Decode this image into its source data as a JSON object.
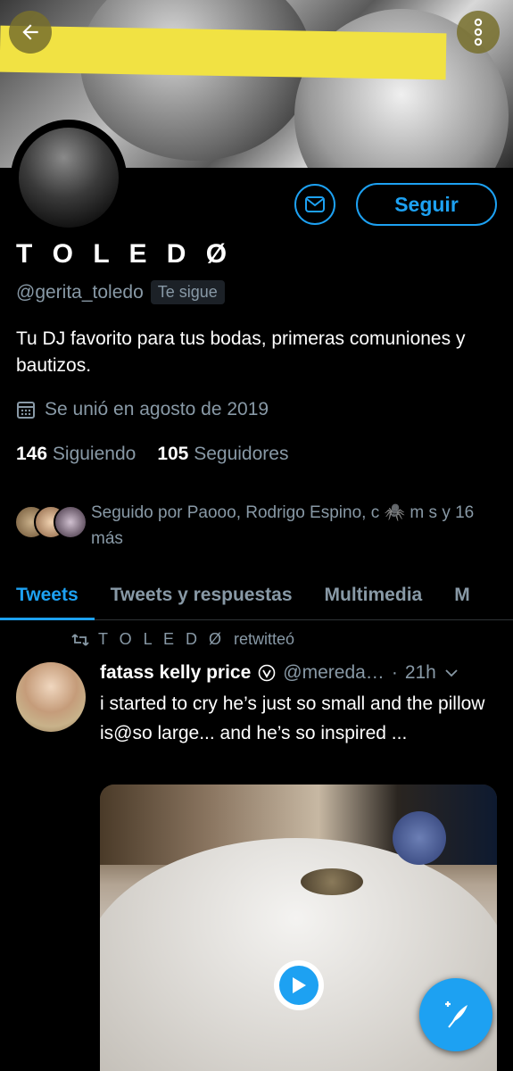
{
  "header": {
    "back_icon": "arrow-left-icon",
    "more_icon": "more-vertical-icon"
  },
  "profile": {
    "name": "T O L E D Ø",
    "handle": "@gerita_toledo",
    "follows_you": "Te sigue",
    "bio": "Tu DJ favorito para tus bodas, primeras comuniones y bautizos.",
    "joined": "Se unió en agosto de 2019",
    "following_count": "146",
    "following_label": "Siguiendo",
    "followers_count": "105",
    "followers_label": "Seguidores",
    "followed_by": "Seguido por Paooo, Rodrigo Espino,  c 🕷️ m s y 16 más"
  },
  "actions": {
    "follow_label": "Seguir",
    "message_icon": "mail-icon"
  },
  "tabs": [
    {
      "label": "Tweets",
      "active": true
    },
    {
      "label": "Tweets y respuestas",
      "active": false
    },
    {
      "label": "Multimedia",
      "active": false
    },
    {
      "label": "M",
      "active": false
    }
  ],
  "tweet": {
    "retweet_by": "T O L E D Ø",
    "retweet_label": "retwitteó",
    "author_name": "fatass kelly price",
    "author_handle": "@mereda…",
    "separator": "·",
    "time": "21h",
    "text": "i started to cry he’s just so small and the pillow is@so large... and he’s so inspired ..."
  },
  "colors": {
    "accent": "#1da1f2",
    "muted": "#8899a6",
    "background": "#000000"
  }
}
